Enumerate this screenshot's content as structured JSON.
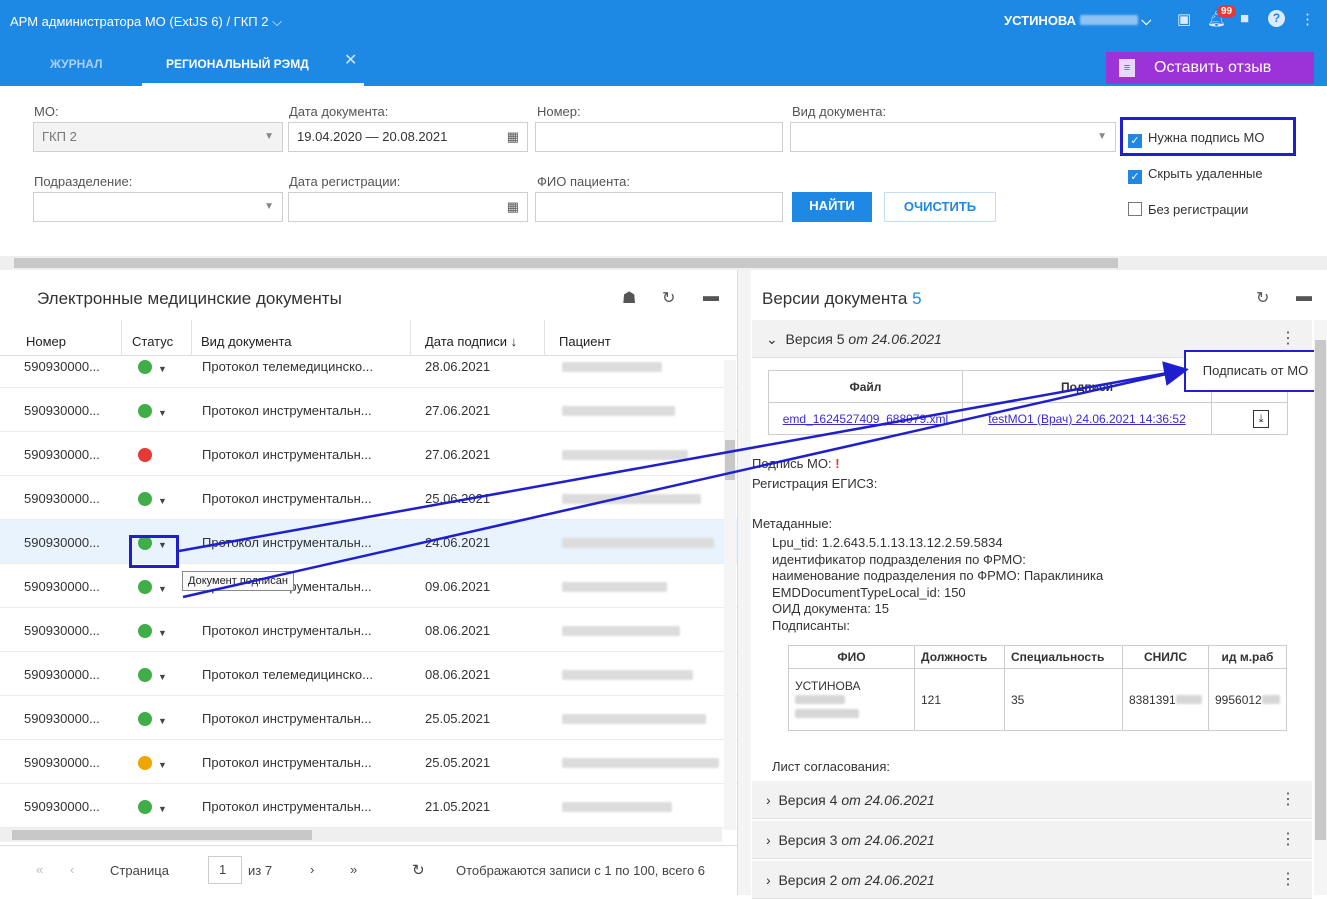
{
  "topbar": {
    "app_title": "АРМ администратора МО (ExtJS 6) / ГКП 2 ⌵",
    "user": "УСТИНОВА",
    "notif_count": "99"
  },
  "tabs": [
    {
      "label": "ЖУРНАЛ"
    },
    {
      "label": "РЕГИОНАЛЬНЫЙ РЭМД"
    }
  ],
  "feedback_label": "Оставить отзыв",
  "filters": {
    "mo_label": "МО:",
    "mo_value": "ГКП 2",
    "doc_date_label": "Дата документа:",
    "doc_date_value": "19.04.2020 — 20.08.2021",
    "number_label": "Номер:",
    "doc_type_label": "Вид документа:",
    "division_label": "Подразделение:",
    "reg_date_label": "Дата регистрации:",
    "patient_label": "ФИО пациента:",
    "find_label": "НАЙТИ",
    "clear_label": "ОЧИСТИТЬ",
    "need_sign_label": "Нужна подпись МО",
    "hide_deleted_label": "Скрыть удаленные",
    "no_reg_label": "Без регистрации"
  },
  "left_panel": {
    "title": "Электронные медицинские документы",
    "columns": [
      "Номер",
      "Статус",
      "Вид документа",
      "Дата подписи ↓",
      "Пациент"
    ],
    "rows": [
      {
        "number": "590930000...",
        "status": "green",
        "doc": "Протокол телемедицинско...",
        "date": "28.06.2021"
      },
      {
        "number": "590930000...",
        "status": "green",
        "doc": "Протокол инструментальн...",
        "date": "27.06.2021"
      },
      {
        "number": "590930000...",
        "status": "red",
        "doc": "Протокол инструментальн...",
        "date": "27.06.2021"
      },
      {
        "number": "590930000...",
        "status": "green",
        "doc": "Протокол инструментальн...",
        "date": "25.06.2021"
      },
      {
        "number": "590930000...",
        "status": "green",
        "doc": "Протокол инструментальн...",
        "date": "24.06.2021"
      },
      {
        "number": "590930000...",
        "status": "green",
        "doc": "Протокол инструментальн...",
        "date": "09.06.2021"
      },
      {
        "number": "590930000...",
        "status": "green",
        "doc": "Протокол инструментальн...",
        "date": "08.06.2021"
      },
      {
        "number": "590930000...",
        "status": "green",
        "doc": "Протокол телемедицинско...",
        "date": "08.06.2021"
      },
      {
        "number": "590930000...",
        "status": "green",
        "doc": "Протокол инструментальн...",
        "date": "25.05.2021"
      },
      {
        "number": "590930000...",
        "status": "orange",
        "doc": "Протокол инструментальн...",
        "date": "25.05.2021"
      },
      {
        "number": "590930000...",
        "status": "green",
        "doc": "Протокол инструментальн...",
        "date": "21.05.2021"
      }
    ],
    "tooltip": "Документ подписан",
    "pager": {
      "page_label": "Страница",
      "page": "1",
      "of": "из 7",
      "info": "Отображаются записи с 1 по 100, всего 6"
    }
  },
  "right_panel": {
    "title": "Версии документа",
    "count": "5",
    "versions": [
      {
        "label": "Версия 5",
        "date": "от 24.06.2021"
      },
      {
        "label": "Версия 4",
        "date": "от 24.06.2021"
      },
      {
        "label": "Версия 3",
        "date": "от 24.06.2021"
      },
      {
        "label": "Версия 2",
        "date": "от 24.06.2021"
      }
    ],
    "file_table": {
      "col_file": "Файл",
      "col_signs": "Подписи",
      "file_link": "emd_1624527409_688979.xml",
      "sign_link": "testMO1 (Врач) 24.06.2021 14:36:52"
    },
    "menu_item": "Подписать от МО",
    "sign_mo": "Подпись МО:",
    "reg_egisz": "Регистрация ЕГИСЗ:",
    "metadata_label": "Метаданные:",
    "meta_lines": [
      "Lpu_tid: 1.2.643.5.1.13.13.12.2.59.5834",
      "идентификатор подразделения по ФРМО:",
      "наименование подразделения по ФРМО: Параклиника",
      "EMDDocumentTypeLocal_id: 150",
      "ОИД документа: 15",
      "Подписанты:"
    ],
    "signers": {
      "cols": [
        "ФИО",
        "Должность",
        "Специальность",
        "СНИЛС",
        "ид м.раб"
      ],
      "fio": "УСТИНОВА",
      "position": "121",
      "specialty": "35",
      "snils": "8381391",
      "workplace_id": "9956012"
    },
    "approval_label": "Лист согласования:"
  }
}
